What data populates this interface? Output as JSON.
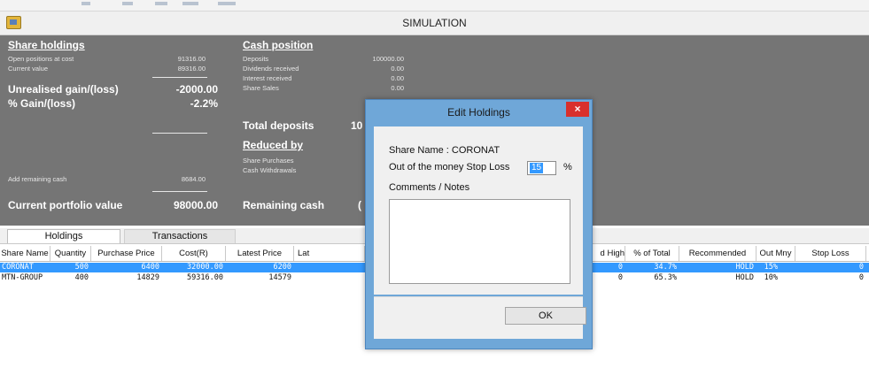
{
  "window": {
    "title": "SIMULATION"
  },
  "share_holdings": {
    "title": "Share holdings",
    "rows": [
      {
        "label": "Open positions at cost",
        "value": "91316.00"
      },
      {
        "label": "Current value",
        "value": "89316.00"
      }
    ],
    "unrealised_label": "Unrealised gain/(loss)",
    "unrealised_value": "-2000.00",
    "pct_label": "% Gain/(loss)",
    "pct_value": "-2.2%",
    "add_cash_label": "Add remaining cash",
    "add_cash_value": "8684.00",
    "current_value_label": "Current portfolio value",
    "current_value_value": "98000.00"
  },
  "cash_position": {
    "title": "Cash position",
    "rows": [
      {
        "label": "Deposits",
        "value": "100000.00"
      },
      {
        "label": "Dividends received",
        "value": "0.00"
      },
      {
        "label": "Interest received",
        "value": "0.00"
      },
      {
        "label": "Share Sales",
        "value": "0.00"
      }
    ],
    "total_label": "Total deposits",
    "total_value": "10",
    "reduced_title": "Reduced by",
    "reduced_rows": [
      {
        "label": "Share Purchases"
      },
      {
        "label": "Cash Withdrawals"
      }
    ],
    "remaining_label": "Remaining cash",
    "remaining_value": "("
  },
  "tabs": [
    "Holdings",
    "Transactions"
  ],
  "grid": {
    "columns": [
      "Share Name",
      "Quantity",
      "Purchase Price",
      "Cost(R)",
      "Latest Price",
      "Lat",
      "d High",
      "% of Total",
      "Recommended",
      "Out Mny",
      "Stop Loss"
    ],
    "rows": [
      {
        "name": "CORONAT",
        "qty": "500",
        "pp": "6400",
        "cost": "32000.00",
        "lp": "6200",
        "high": "0",
        "pct": "34.7%",
        "rec": "HOLD",
        "out": "15%",
        "stop": "0"
      },
      {
        "name": "MTN-GROUP",
        "qty": "400",
        "pp": "14829",
        "cost": "59316.00",
        "lp": "14579",
        "high": "0",
        "pct": "65.3%",
        "rec": "HOLD",
        "out": "10%",
        "stop": "0"
      }
    ]
  },
  "dialog": {
    "title": "Edit Holdings",
    "close": "×",
    "share_name": "Share Name : CORONAT",
    "stop_loss_label": "Out of the money Stop Loss",
    "stop_loss_value": "15",
    "percent": "%",
    "comments_label": "Comments / Notes",
    "ok": "OK"
  },
  "colors": {
    "panel": "#757575",
    "selection": "#3399ff",
    "dialog_frame": "#6fa7d8",
    "close": "#d9302c"
  }
}
